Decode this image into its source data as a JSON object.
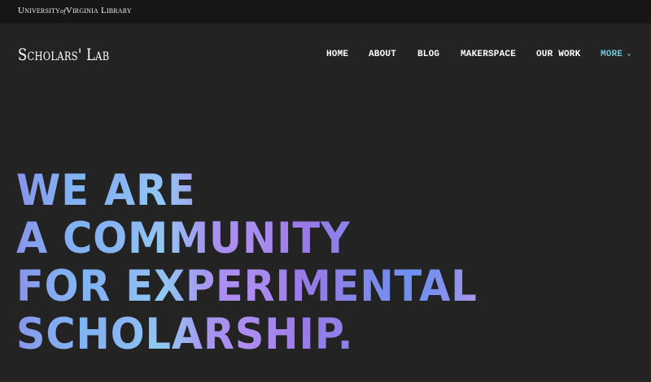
{
  "topbar": {
    "logo_left": "University",
    "logo_of": "of",
    "logo_right": "Virginia Library"
  },
  "header": {
    "site_title": "Scholars' Lab"
  },
  "nav": {
    "home": "HOME",
    "about": "ABOUT",
    "blog": "BLOG",
    "makerspace": "MAKERSPACE",
    "our_work": "OUR WORK",
    "more": "MORE",
    "more_caret": "⌄",
    "more_color": "#6fc9de"
  },
  "hero": {
    "lines": [
      "WE ARE",
      "A COMMUNITY",
      "FOR EXPERIMENTAL",
      "SCHOLARSHIP."
    ]
  },
  "colors": {
    "background": "#232323",
    "topbar": "#161616",
    "hero_text_gradient": [
      "#8a86e8",
      "#9fb5f5",
      "#9878e6",
      "#7e93ef",
      "#a88ce8"
    ]
  }
}
